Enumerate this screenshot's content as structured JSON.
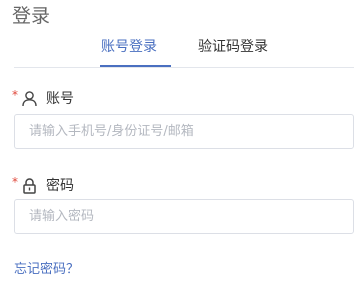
{
  "header": {
    "title": "登录"
  },
  "tabs": [
    {
      "label": "账号登录",
      "active": true
    },
    {
      "label": "验证码登录",
      "active": false
    }
  ],
  "form": {
    "account": {
      "required_mark": "*",
      "label": "账号",
      "icon": "user-icon",
      "value": "",
      "placeholder": "请输入手机号/身份证号/邮箱"
    },
    "password": {
      "required_mark": "*",
      "label": "密码",
      "icon": "lock-icon",
      "value": "",
      "placeholder": "请输入密码"
    }
  },
  "links": {
    "forgot_password": "忘记密码？"
  },
  "colors": {
    "accent": "#4a6fc0",
    "required": "#e0483b",
    "border": "#dcdfe6",
    "placeholder": "#b4b8c0"
  }
}
